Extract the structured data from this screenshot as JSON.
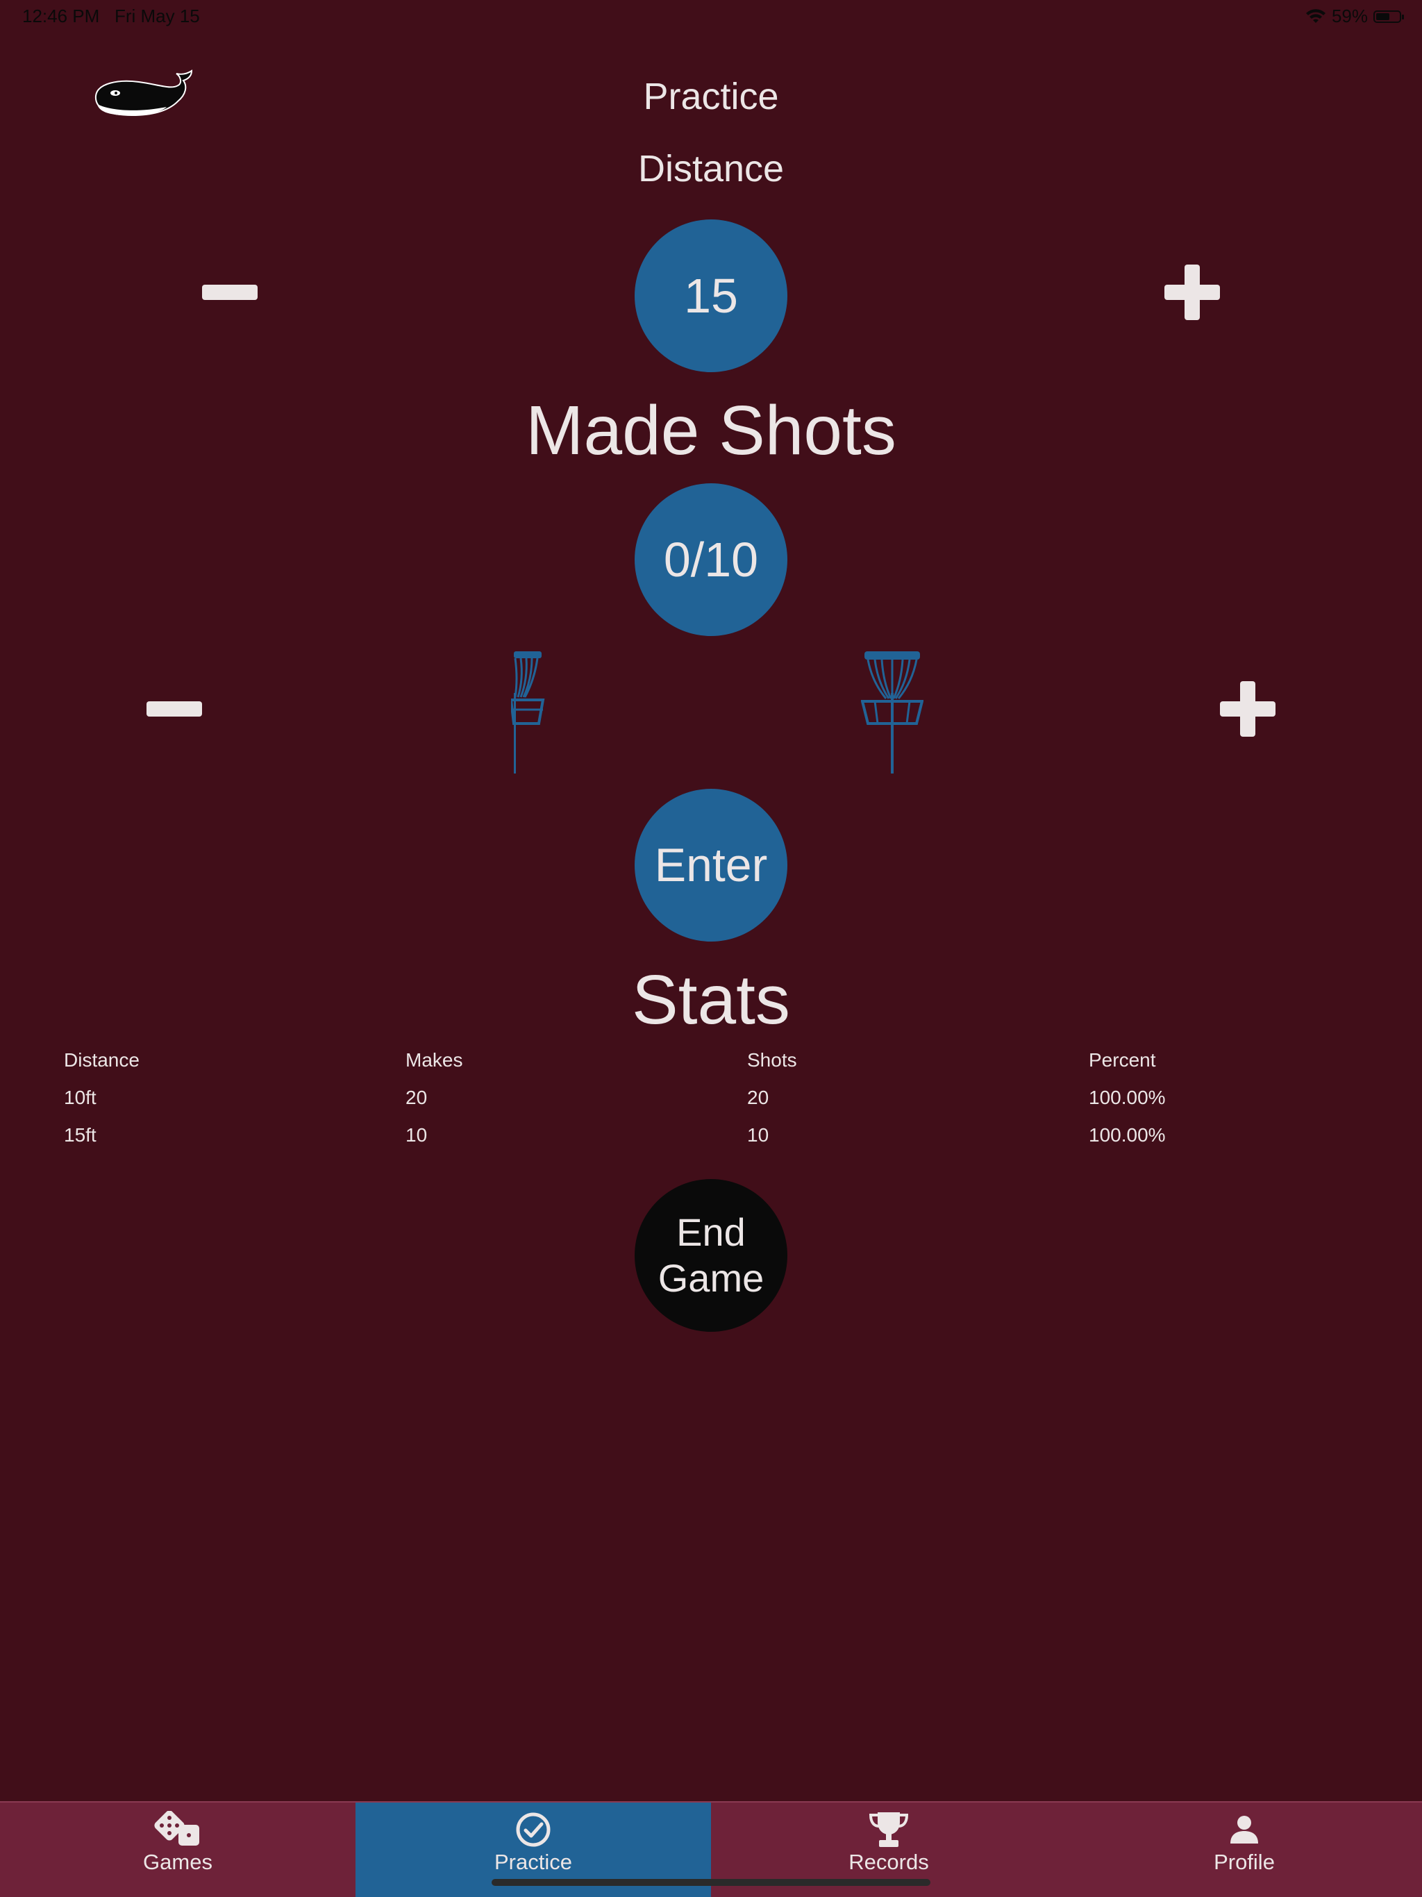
{
  "status_bar": {
    "time": "12:46 PM",
    "date": "Fri May 15",
    "battery_text": "59%",
    "battery_level": 0.59
  },
  "header": {
    "title": "Practice",
    "logo_icon": "whale-logo"
  },
  "distance": {
    "label": "Distance",
    "value": "15"
  },
  "made_shots": {
    "label": "Made Shots",
    "value": "0/10"
  },
  "controls": {
    "minus_icon": "minus-icon",
    "plus_icon": "plus-icon",
    "basket_icon": "disc-golf-basket-icon"
  },
  "enter_label": "Enter",
  "stats": {
    "label": "Stats",
    "columns": [
      "Distance",
      "Makes",
      "Shots",
      "Percent"
    ],
    "rows": [
      [
        "10ft",
        "20",
        "20",
        "100.00%"
      ],
      [
        "15ft",
        "10",
        "10",
        "100.00%"
      ]
    ]
  },
  "end_game_label": "End\nGame",
  "tabs": [
    {
      "label": "Games",
      "icon": "dice-icon",
      "active": false
    },
    {
      "label": "Practice",
      "icon": "check-circle-icon",
      "active": true
    },
    {
      "label": "Records",
      "icon": "trophy-icon",
      "active": false
    },
    {
      "label": "Profile",
      "icon": "person-icon",
      "active": false
    }
  ],
  "colors": {
    "background": "#410e19",
    "accent": "#216396",
    "tabbar": "#6e2239",
    "end_button": "#0a0a0a"
  }
}
